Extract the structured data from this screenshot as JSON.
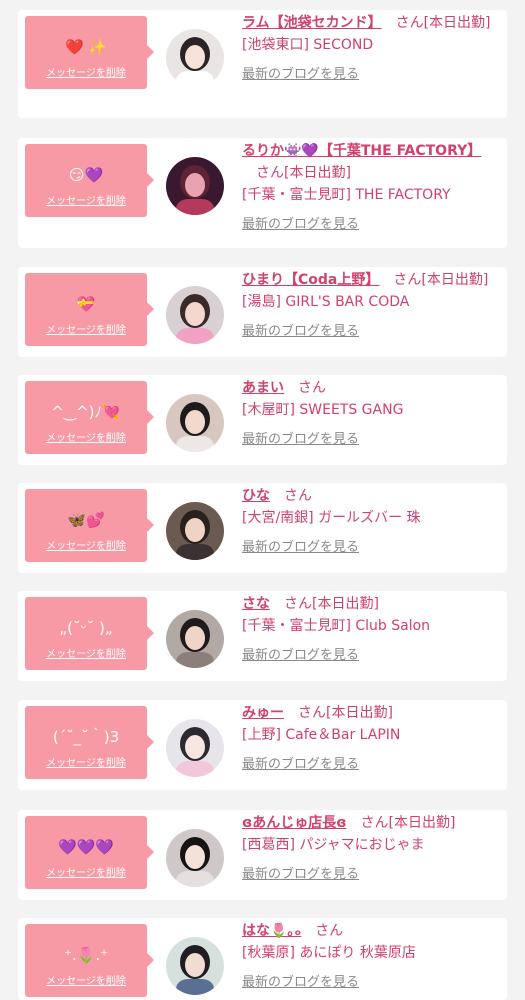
{
  "delete_label": "メッセージを削除",
  "blog_label": "最新のブログを見る",
  "honorific": "さん",
  "colors": {
    "background": "#f3f3f3",
    "card": "#ffffff",
    "bubble": "#f79aa6",
    "name": "#d2416b",
    "link_gray": "#8a8a8a"
  },
  "cards": [
    {
      "message": "❤️ ✨",
      "name": "ラム【池袋セカンド】",
      "status": "[本日出勤]",
      "shop": "[池袋東口] SECOND",
      "avatar": {
        "bg": "#e9e5e4",
        "skin": "#f6e2d8",
        "hair": "#2b2426",
        "cloth": "#ffffff"
      }
    },
    {
      "message": "😏💜",
      "name": "るりか👾💜【千葉THE FACTORY】",
      "status": "[本日出勤]",
      "shop": "[千葉・富士見町] THE FACTORY",
      "avatar": {
        "bg": "#3a1830",
        "skin": "#e8a3b0",
        "hair": "#5c2434",
        "cloth": "#b33a5b"
      }
    },
    {
      "message": "💝",
      "name": "ひまり【Coda上野】",
      "status": "[本日出勤]",
      "shop": "[湯島] GIRL'S BAR CODA",
      "avatar": {
        "bg": "#d9d0d4",
        "skin": "#f4d8cf",
        "hair": "#3a2a2a",
        "cloth": "#f1a2c4"
      }
    },
    {
      "message": "^‿^)ﾉ💘",
      "name": "あまい",
      "status": "",
      "shop": "[木屋町] SWEETS GANG",
      "avatar": {
        "bg": "#d7c7c0",
        "skin": "#f1d9cd",
        "hair": "#1e1a1b",
        "cloth": "#ede7e5"
      }
    },
    {
      "message": "🦋💕",
      "name": "ひな",
      "status": "",
      "shop": "[大宮/南銀] ガールズバー 珠",
      "avatar": {
        "bg": "#6a5a52",
        "skin": "#efd3c5",
        "hair": "#2a201c",
        "cloth": "#3b3132"
      }
    },
    {
      "message": "„(˘ᵕ˘ )„",
      "name": "さな",
      "status": "[本日出勤]",
      "shop": "[千葉・富士見町] Club Salon",
      "avatar": {
        "bg": "#b3a9a4",
        "skin": "#efd5c8",
        "hair": "#1f1b1c",
        "cloth": "#8c7f7b"
      }
    },
    {
      "message": "(´˘_˘｀)3",
      "name": "みゅー",
      "status": "[本日出勤]",
      "shop": "[上野] Cafe＆Bar LAPIN",
      "avatar": {
        "bg": "#e8e5ea",
        "skin": "#f7e6e1",
        "hair": "#2c2a30",
        "cloth": "#f2c7d9"
      }
    },
    {
      "message": "💜💜💜",
      "name": "ɞあんじゅ店長ɞ",
      "status": "[本日出勤]",
      "shop": "[西葛西] パジャマにおじゃま",
      "avatar": {
        "bg": "#cfc7c8",
        "skin": "#f4e1da",
        "hair": "#161314",
        "cloth": "#e6dfe0"
      }
    },
    {
      "message": "⁺.🌷.⁺",
      "name": "はな🌷｡ₒ",
      "status": "",
      "shop": "[秋葉原] あにぽり 秋葉原店",
      "avatar": {
        "bg": "#d6e1dd",
        "skin": "#f1dcd2",
        "hair": "#1e1e22",
        "cloth": "#5a6f93"
      }
    }
  ]
}
